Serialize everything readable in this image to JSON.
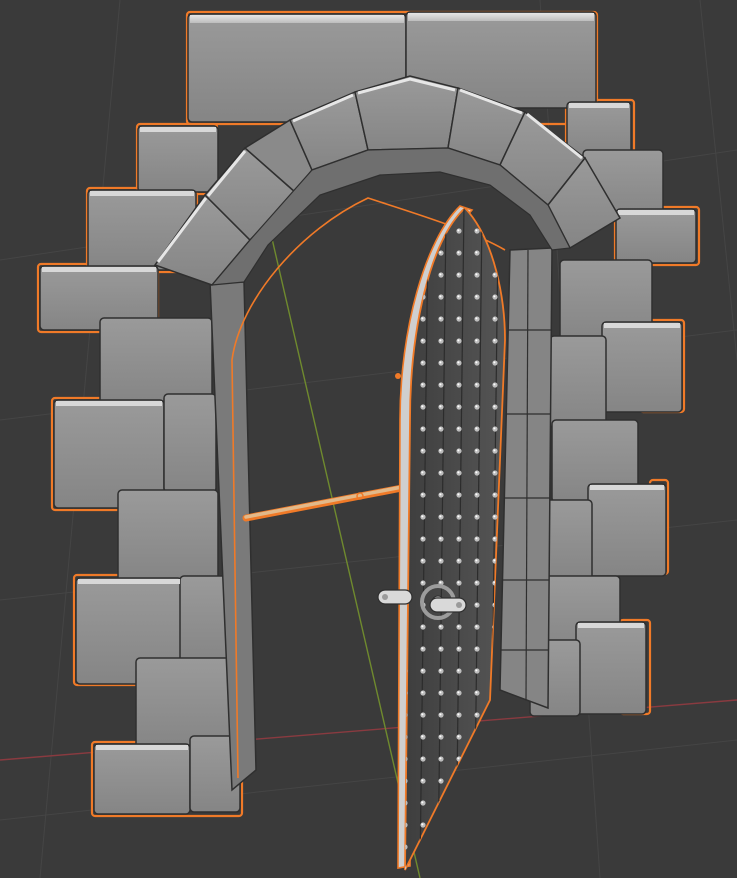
{
  "viewport": {
    "background_color": "#3a3a3a",
    "grid_color": "#444444",
    "x_axis_color": "#8a3a40",
    "y_axis_color": "#6f8a2e",
    "selection_outline_color": "#f07a28",
    "stone_color": "#8e8e8e",
    "door_color": "#4a4a4a",
    "origin_color": "#f07a28"
  },
  "scene": {
    "objects": [
      {
        "name": "stone-archway",
        "type": "mesh",
        "selected": true
      },
      {
        "name": "arched-door",
        "type": "mesh",
        "selected": true
      },
      {
        "name": "door-bar",
        "type": "mesh",
        "selected": true
      }
    ]
  }
}
